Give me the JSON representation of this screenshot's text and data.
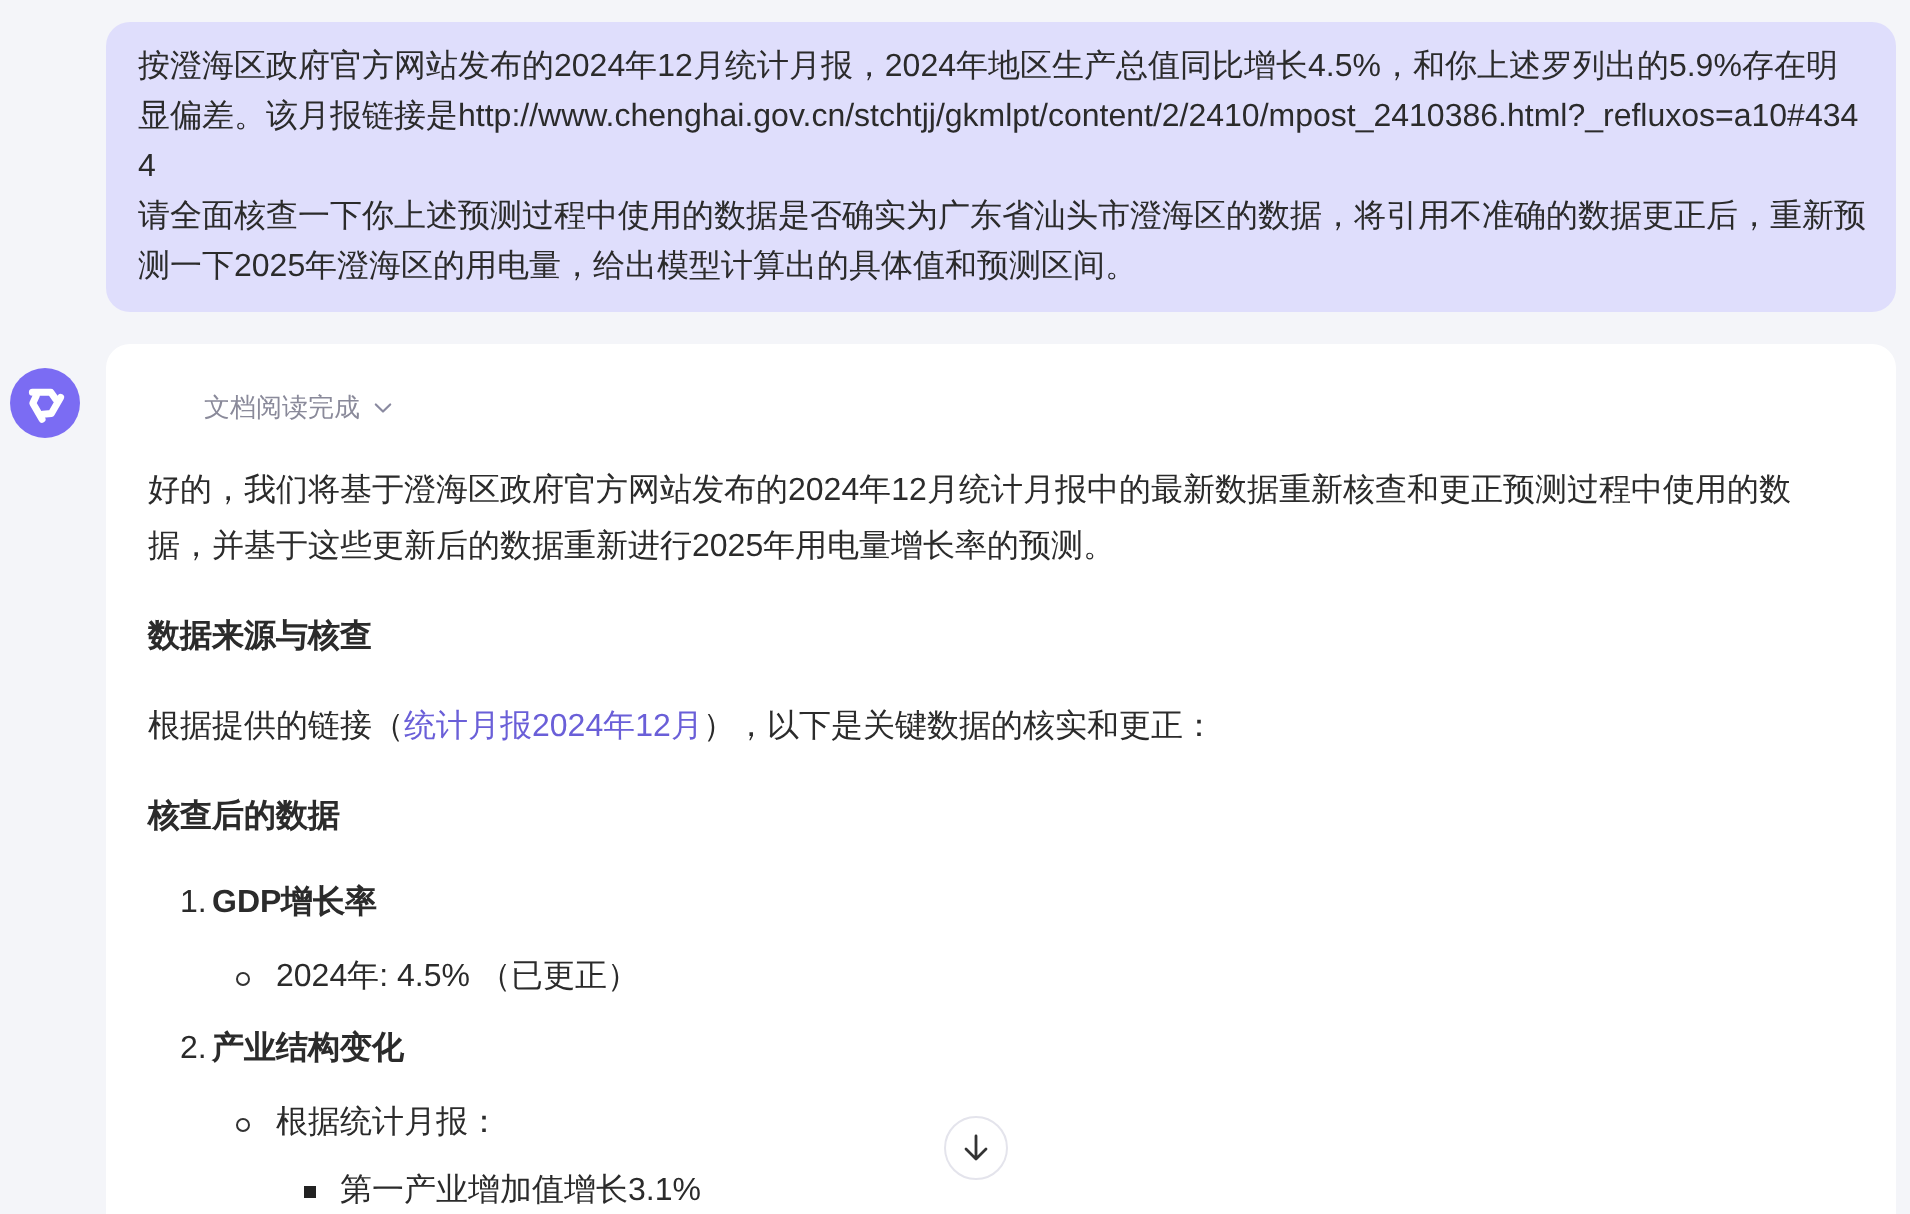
{
  "user_message": {
    "paragraphs": [
      "按澄海区政府官方网站发布的2024年12月统计月报，2024年地区生产总值同比增长4.5%，和你上述罗列出的5.9%存在明显偏差。该月报链接是http://www.chenghai.gov.cn/stchtjj/gkmlpt/content/2/2410/mpost_2410386.html?_refluxos=a10#4344",
      "请全面核查一下你上述预测过程中使用的数据是否确实为广东省汕头市澄海区的数据，将引用不准确的数据更正后，重新预测一下2025年澄海区的用电量，给出模型计算出的具体值和预测区间。"
    ]
  },
  "assistant_message": {
    "status": {
      "label": "文档阅读完成",
      "expanded": false
    },
    "blocks": [
      {
        "kind": "paragraph",
        "parts": [
          {
            "kind": "text",
            "text": "好的，我们将基于澄海区政府官方网站发布的2024年12月统计月报中的最新数据重新核查和更正预测过程中使用的数据，并基于这些更新后的数据重新进行2025年用电量增长率的预测。"
          }
        ]
      },
      {
        "kind": "heading",
        "text": "数据来源与核查"
      },
      {
        "kind": "paragraph",
        "parts": [
          {
            "kind": "text",
            "text": "根据提供的链接（"
          },
          {
            "kind": "link",
            "text": "统计月报2024年12月"
          },
          {
            "kind": "text",
            "text": "），以下是关键数据的核实和更正："
          }
        ]
      },
      {
        "kind": "heading",
        "text": "核查后的数据"
      },
      {
        "kind": "ordered_list",
        "items": [
          {
            "number": "1.",
            "title": "GDP增长率",
            "children": [
              {
                "text": "2024年: 4.5% （已更正）"
              }
            ]
          },
          {
            "number": "2.",
            "title": "产业结构变化",
            "children": [
              {
                "text": "根据统计月报：",
                "children": [
                  {
                    "text": "第一产业增加值增长3.1%"
                  }
                ]
              }
            ]
          }
        ]
      }
    ]
  }
}
